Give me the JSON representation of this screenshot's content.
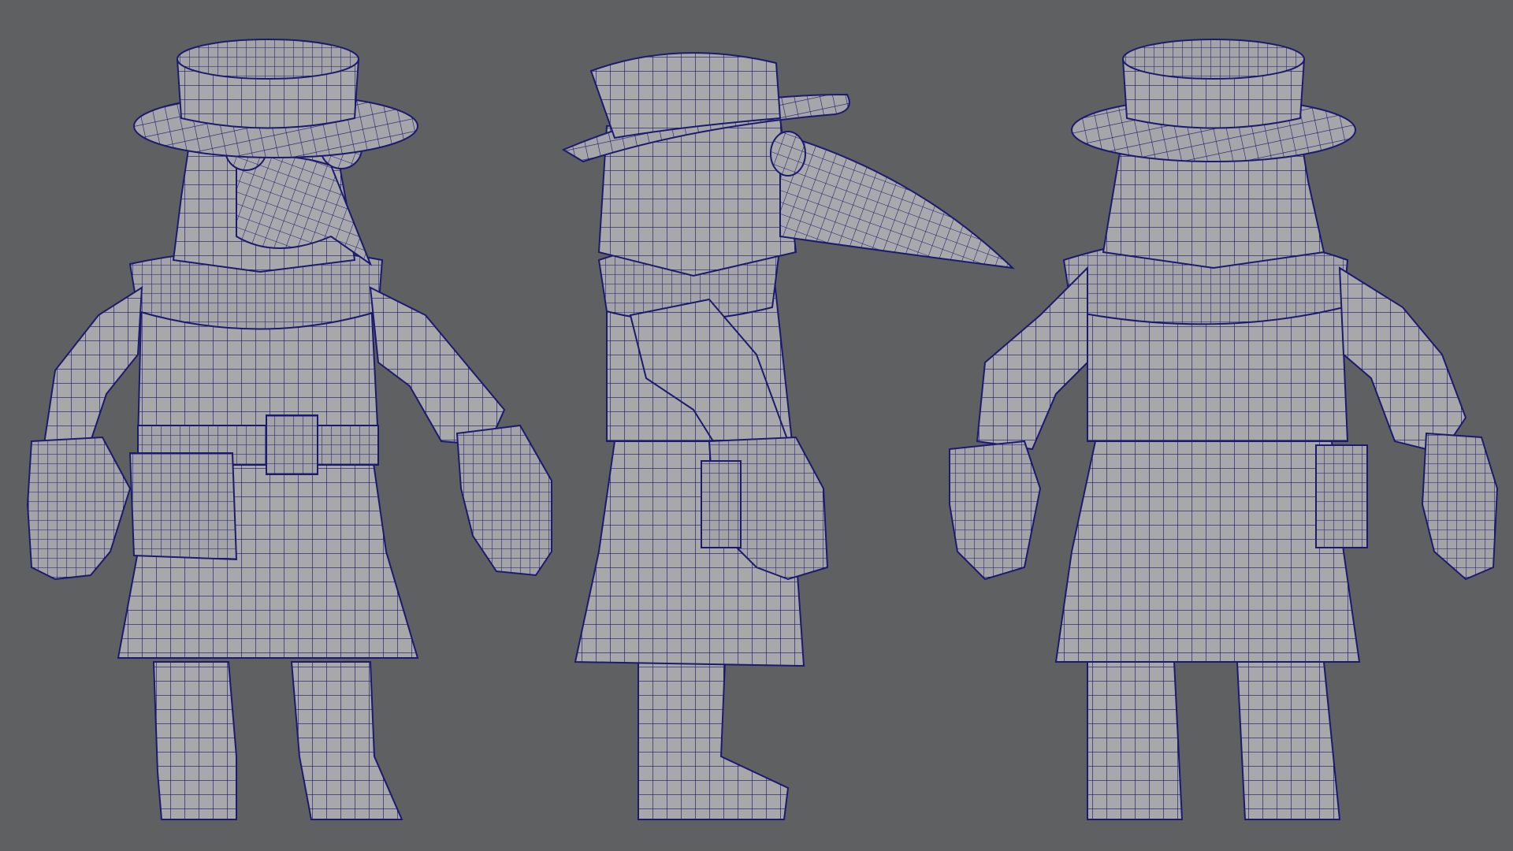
{
  "viewport": {
    "background_color": "#5f6062",
    "mesh_fill_color": "#a8a8ab",
    "mesh_shade_color": "#8f8f93",
    "wire_color": "#1c1a6e"
  },
  "views": [
    {
      "name": "front-view"
    },
    {
      "name": "side-view"
    },
    {
      "name": "back-view"
    }
  ]
}
